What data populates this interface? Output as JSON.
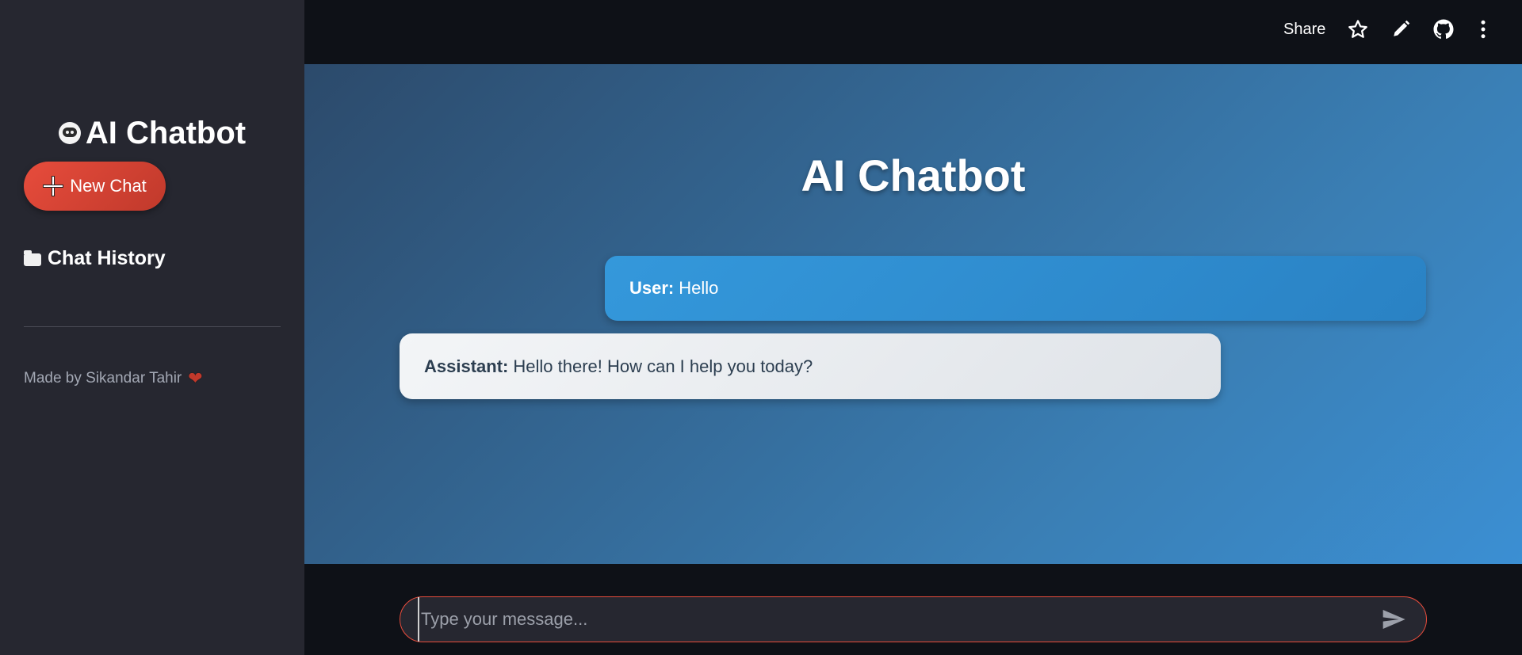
{
  "sidebar": {
    "title": "AI Chatbot",
    "title_icon": "robot-icon",
    "new_chat_label": "New Chat",
    "new_chat_icon": "plus-icon",
    "history_label": "Chat History",
    "history_icon": "folder-icon",
    "footer_text": "Made by Sikandar Tahir",
    "footer_icon": "heart-icon"
  },
  "topbar": {
    "share_label": "Share",
    "icons": [
      "star-icon",
      "pencil-icon",
      "github-icon",
      "more-vertical-icon"
    ]
  },
  "main": {
    "title": "AI Chatbot",
    "messages": [
      {
        "role_label": "User:",
        "text": "Hello"
      },
      {
        "role_label": "Assistant:",
        "text": "Hello there! How can I help you today?"
      }
    ]
  },
  "input": {
    "placeholder": "Type your message...",
    "value": "",
    "send_icon": "send-icon"
  },
  "colors": {
    "sidebar_bg": "#262730",
    "app_bg": "#0e1117",
    "accent_red": "#e74c3c",
    "user_bubble": "#3498db",
    "assistant_bubble": "#eceff2",
    "heart": "#c0392b"
  }
}
